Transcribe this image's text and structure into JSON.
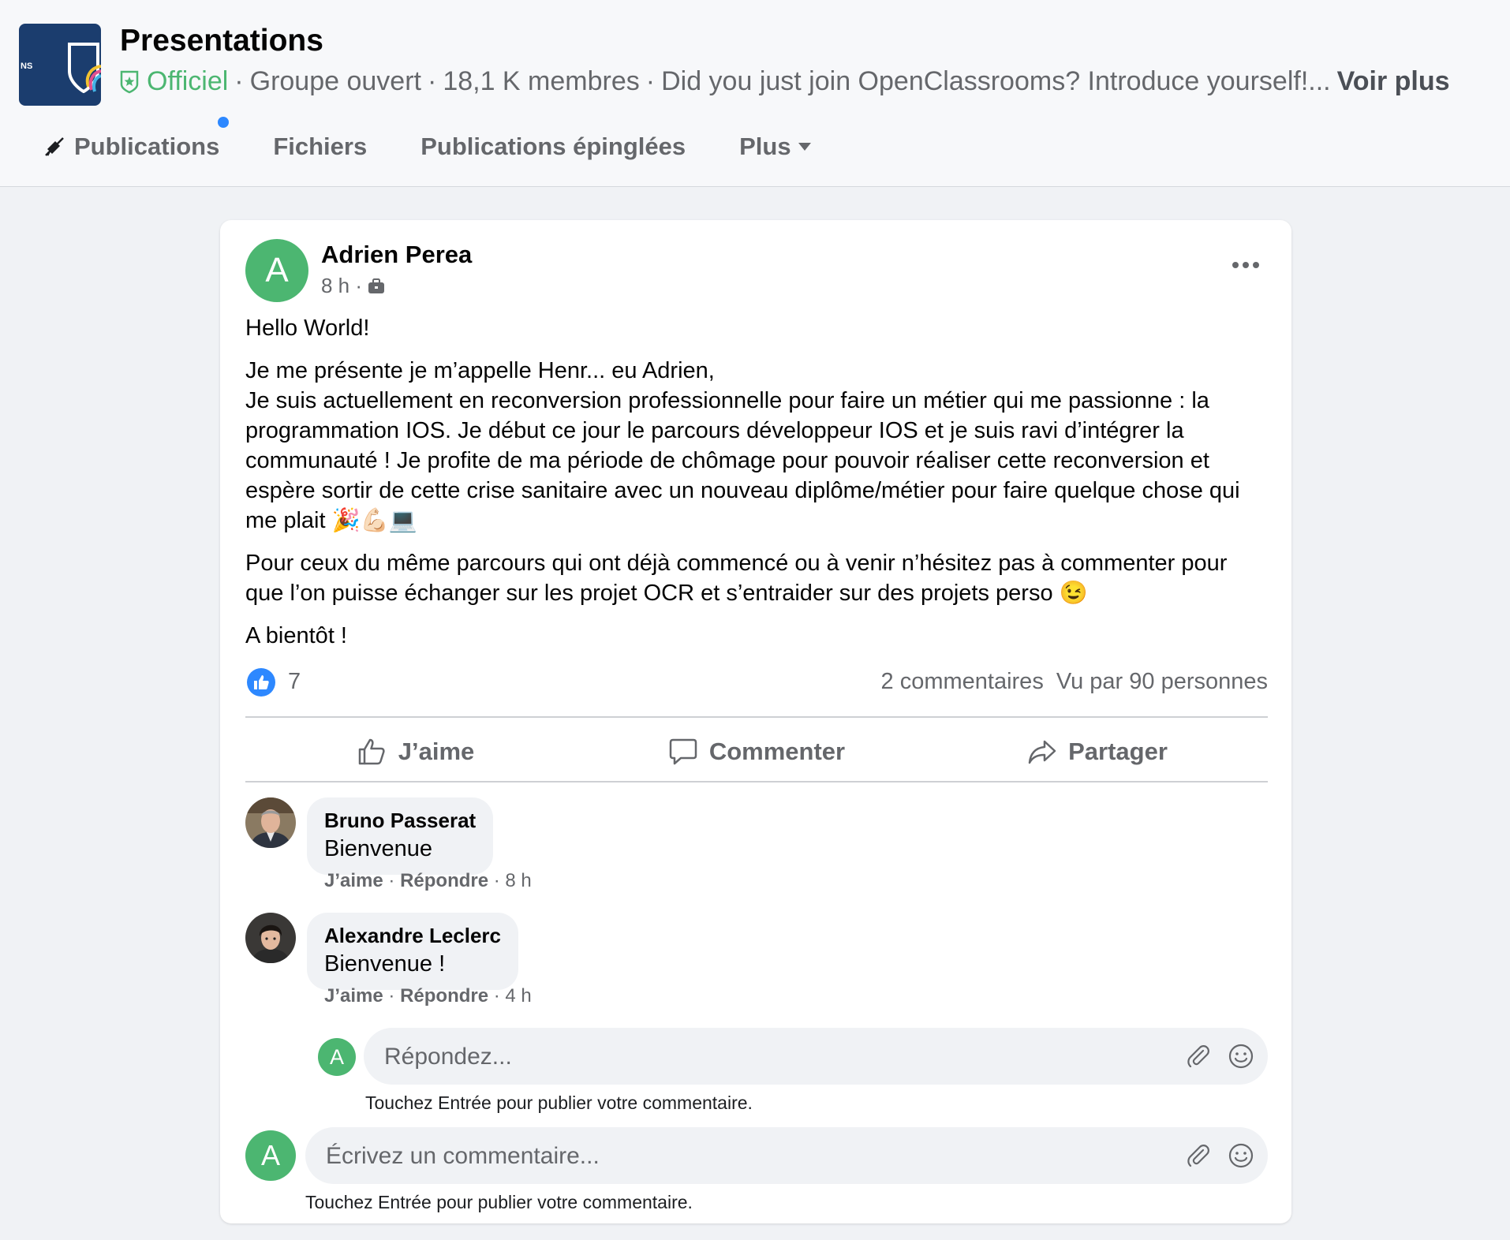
{
  "header": {
    "logo_text": "NS",
    "title": "Presentations",
    "meta": {
      "official": "Officiel",
      "separator": "·",
      "group_type": "Groupe ouvert",
      "members": "18,1 K membres",
      "description": "Did you just join OpenClassrooms? Introduce yourself!...",
      "see_more": "Voir plus"
    },
    "tabs": [
      {
        "label": "Publications"
      },
      {
        "label": "Fichiers"
      },
      {
        "label": "Publications épinglées"
      },
      {
        "label": "Plus"
      }
    ]
  },
  "post": {
    "avatar_letter": "A",
    "author": "Adrien Perea",
    "time": "8 h ·",
    "paragraphs": [
      "Hello World!",
      "Je me présente je m’appelle Henr... eu Adrien,\nJe suis actuellement en reconversion professionnelle pour faire un métier qui me passionne : la programmation IOS. Je début ce jour le parcours développeur IOS et je suis ravi d’intégrer la communauté ! Je profite de ma période de chômage pour pouvoir réaliser cette reconversion et espère sortir de cette crise sanitaire avec un nouveau diplôme/métier pour faire quelque chose qui me plait 🎉💪🏻💻",
      "Pour ceux du même parcours qui ont déjà commencé ou à venir n’hésitez pas à commenter pour que l’on puisse échanger sur les projet OCR et s’entraider sur des projets perso 😉",
      "A bientôt !"
    ],
    "likes": "7",
    "comments_count": "2 commentaires",
    "views": "Vu par 90 personnes",
    "actions": {
      "like": "J’aime",
      "comment": "Commenter",
      "share": "Partager"
    }
  },
  "comments": [
    {
      "name": "Bruno Passerat",
      "text": "Bienvenue",
      "like": "J’aime",
      "reply": "Répondre",
      "time": "· 8 h"
    },
    {
      "name": "Alexandre Leclerc",
      "text": "Bienvenue !",
      "like": "J’aime",
      "reply": "Répondre",
      "time": "· 4 h"
    }
  ],
  "reply_box": {
    "avatar_letter": "A",
    "placeholder": "Répondez...",
    "hint": "Touchez Entrée pour publier votre commentaire."
  },
  "comment_box": {
    "avatar_letter": "A",
    "placeholder": "Écrivez un commentaire...",
    "hint": "Touchez Entrée pour publier votre commentaire."
  },
  "colors": {
    "official_green": "#4cb671",
    "like_blue": "#2d88ff",
    "group_logo_navy": "#1b3d6e"
  },
  "icons": [
    "shield-star-icon",
    "megaphone-muted-icon",
    "caret-down-icon",
    "briefcase-icon",
    "more-dots-icon",
    "like-badge-icon",
    "thumbs-up-icon",
    "comment-icon",
    "share-icon",
    "paperclip-icon",
    "smiley-icon"
  ]
}
